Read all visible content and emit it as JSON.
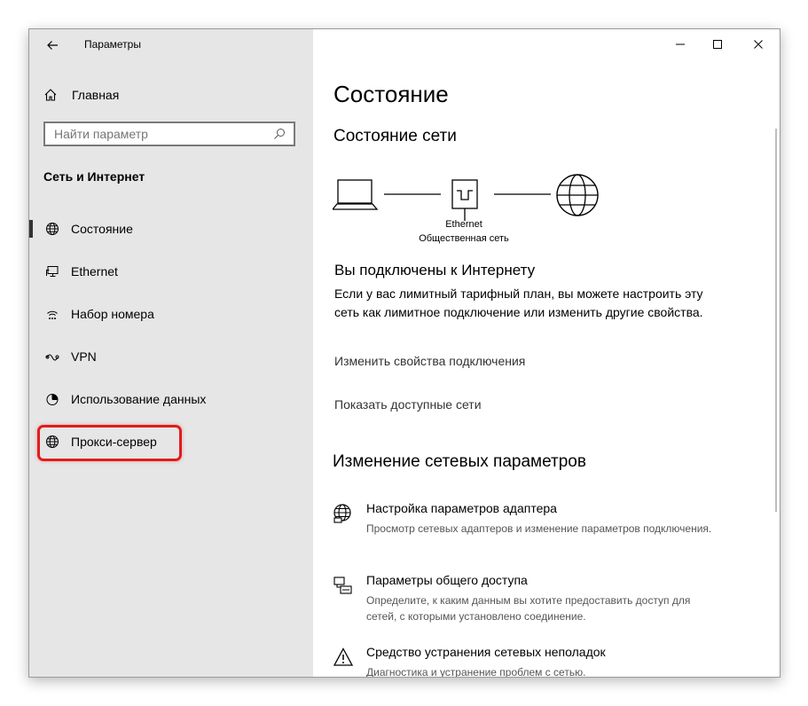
{
  "window": {
    "title": "Параметры"
  },
  "sidebar": {
    "home_label": "Главная",
    "search_placeholder": "Найти параметр",
    "section_heading": "Сеть и Интернет",
    "items": [
      {
        "label": "Состояние",
        "icon": "globe-icon",
        "selected": true
      },
      {
        "label": "Ethernet",
        "icon": "ethernet-icon",
        "selected": false
      },
      {
        "label": "Набор номера",
        "icon": "dialup-icon",
        "selected": false
      },
      {
        "label": "VPN",
        "icon": "vpn-icon",
        "selected": false
      },
      {
        "label": "Использование данных",
        "icon": "data-usage-icon",
        "selected": false
      },
      {
        "label": "Прокси-сервер",
        "icon": "globe-icon",
        "selected": false,
        "highlighted": true
      }
    ]
  },
  "content": {
    "title": "Состояние",
    "network_status_heading": "Состояние сети",
    "diagram": {
      "adapter_name": "Ethernet",
      "network_type": "Общественная сеть"
    },
    "connected_heading": "Вы подключены к Интернету",
    "connected_desc": "Если у вас лимитный тарифный план, вы можете настроить эту сеть как лимитное подключение или изменить другие свойства.",
    "link_change_props": "Изменить свойства подключения",
    "link_show_networks": "Показать доступные сети",
    "change_settings_heading": "Изменение сетевых параметров",
    "options": [
      {
        "title": "Настройка параметров адаптера",
        "desc": "Просмотр сетевых адаптеров и изменение параметров подключения.",
        "icon": "adapter-settings-icon"
      },
      {
        "title": "Параметры общего доступа",
        "desc": "Определите, к каким данным вы хотите предоставить доступ для сетей, с которыми установлено соединение.",
        "icon": "sharing-icon"
      },
      {
        "title": "Средство устранения сетевых неполадок",
        "desc": "Диагностика и устранение проблем с сетью.",
        "icon": "warning-icon"
      }
    ]
  },
  "colors": {
    "sidebar_bg": "#e6e6e6",
    "highlight_border": "#e11b1b",
    "selected_bar": "#333333"
  }
}
